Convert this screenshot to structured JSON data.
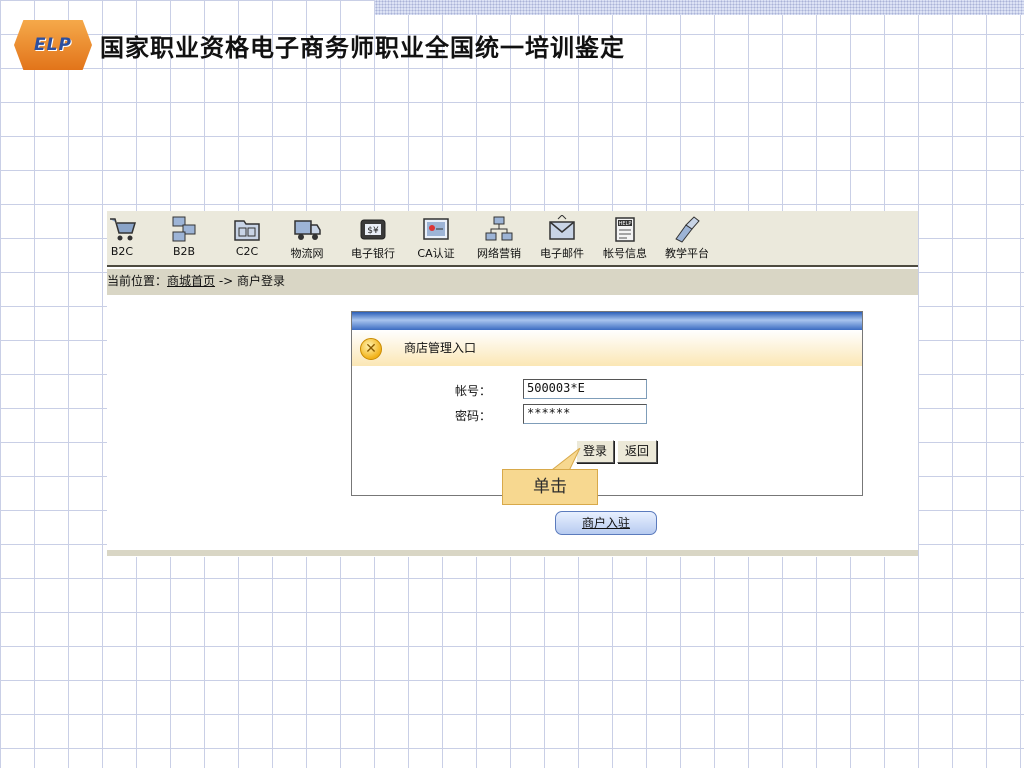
{
  "slide": {
    "logo_text": "ELP",
    "title": "国家职业资格电子商务师职业全国统一培训鉴定"
  },
  "toolbar": {
    "items": [
      {
        "label": "B2C",
        "icon": "shopping-cart-icon"
      },
      {
        "label": "B2B",
        "icon": "b2b-network-icon"
      },
      {
        "label": "C2C",
        "icon": "c2c-folder-icon"
      },
      {
        "label": "物流网",
        "icon": "truck-icon"
      },
      {
        "label": "电子银行",
        "icon": "bank-icon"
      },
      {
        "label": "CA认证",
        "icon": "certificate-icon"
      },
      {
        "label": "网络营销",
        "icon": "network-marketing-icon"
      },
      {
        "label": "电子邮件",
        "icon": "email-icon"
      },
      {
        "label": "帐号信息",
        "icon": "help-notepad-icon"
      },
      {
        "label": "教学平台",
        "icon": "teaching-platform-icon"
      }
    ]
  },
  "breadcrumb": {
    "prefix": "当前位置：",
    "home_link": "商城首页",
    "separator": " -> ",
    "current": "商户登录"
  },
  "login_panel": {
    "title": "商店管理入口",
    "account_label": "帐号：",
    "account_value": "500003*E",
    "password_label": "密码：",
    "password_value": "******",
    "login_button": "登录",
    "back_button": "返回"
  },
  "register_button": "商户入驻",
  "callout": {
    "text": "单击"
  },
  "colors": {
    "toolbar_bg": "#ebe9dc",
    "breadcrumb_bg": "#d9d6c5",
    "panel_header_blue": "#2c5fb8",
    "callout_bg": "#f7d890"
  }
}
